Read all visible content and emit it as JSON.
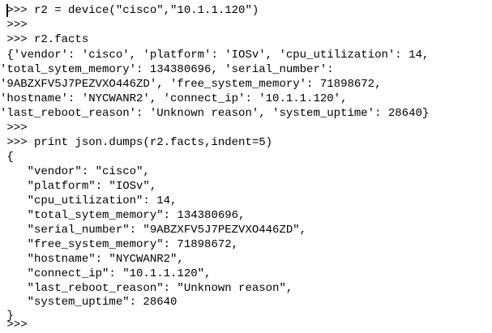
{
  "console": {
    "lines": [
      " >>> r2 = device(\"cisco\",\"10.1.1.120\")",
      " >>>",
      " >>> r2.facts",
      " {'vendor': 'cisco', 'platform': 'IOSv', 'cpu_utilization': 14,",
      "'total_sytem_memory': 134380696, 'serial_number':",
      "'9ABZXFV5J7PEZVXO446ZD', 'free_system_memory': 71898672,",
      "'hostname': 'NYCWANR2', 'connect_ip': '10.1.1.120',",
      "'last_reboot_reason': 'Unknown reason', 'system_uptime': 28640}",
      " >>>",
      " >>> print json.dumps(r2.facts,indent=5)",
      " {",
      "    \"vendor\": \"cisco\",",
      "    \"platform\": \"IOSv\",",
      "    \"cpu_utilization\": 14,",
      "    \"total_sytem_memory\": 134380696,",
      "    \"serial_number\": \"9ABZXFV5J7PEZVXO446ZD\",",
      "    \"free_system_memory\": 71898672,",
      "    \"hostname\": \"NYCWANR2\",",
      "    \"connect_ip\": \"10.1.1.120\",",
      "    \"last_reboot_reason\": \"Unknown reason\",",
      "    \"system_uptime\": 28640",
      " }",
      " >>>"
    ]
  }
}
